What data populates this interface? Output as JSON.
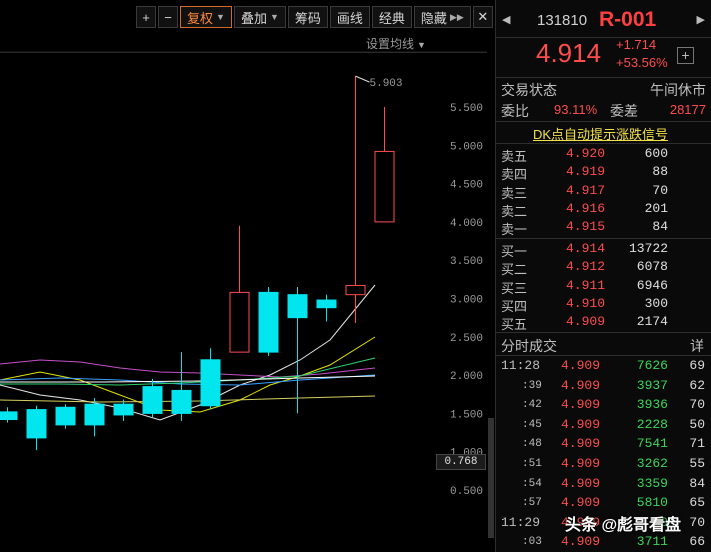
{
  "toolbar": {
    "plus": "+",
    "minus": "−",
    "fuquan": "复权",
    "diejia": "叠加",
    "chouma": "筹码",
    "huaxian": "画线",
    "jingdian": "经典",
    "yincang": "隐藏",
    "set_ma": "设置均线"
  },
  "colors": {
    "up": "#ff4d4d",
    "down": "#00e5ee",
    "accent": "#ff8a3d",
    "trade_vol": "#3cd65a"
  },
  "chart_data": {
    "type": "candlestick",
    "ylabels": [
      "5.500",
      "5.000",
      "4.500",
      "4.000",
      "3.500",
      "3.000",
      "2.500",
      "2.000",
      "1.500",
      "1.000",
      "0.500"
    ],
    "current_price_label": "0.768",
    "high_annotation": "5.903",
    "candles": [
      {
        "o": 1.52,
        "c": 1.42,
        "h": 1.58,
        "l": 1.38
      },
      {
        "o": 1.55,
        "c": 1.18,
        "h": 1.6,
        "l": 1.02
      },
      {
        "o": 1.58,
        "c": 1.35,
        "h": 1.62,
        "l": 1.3
      },
      {
        "o": 1.62,
        "c": 1.35,
        "h": 1.7,
        "l": 1.2
      },
      {
        "o": 1.62,
        "c": 1.48,
        "h": 1.68,
        "l": 1.4
      },
      {
        "o": 1.85,
        "c": 1.5,
        "h": 1.95,
        "l": 1.45
      },
      {
        "o": 1.8,
        "c": 1.5,
        "h": 2.3,
        "l": 1.4
      },
      {
        "o": 2.2,
        "c": 1.6,
        "h": 2.35,
        "l": 1.55
      },
      {
        "o": 2.3,
        "c": 3.08,
        "h": 3.95,
        "l": 2.3
      },
      {
        "o": 3.08,
        "c": 2.3,
        "h": 3.15,
        "l": 2.25
      },
      {
        "o": 3.05,
        "c": 2.75,
        "h": 3.15,
        "l": 1.5
      },
      {
        "o": 2.98,
        "c": 2.88,
        "h": 3.05,
        "l": 2.7
      },
      {
        "o": 3.05,
        "c": 3.17,
        "h": 5.903,
        "l": 2.68
      },
      {
        "o": 4.0,
        "c": 4.92,
        "h": 5.5,
        "l": 4.0
      }
    ]
  },
  "quote": {
    "prev": "◀",
    "next": "▶",
    "code": "131810",
    "name": "R-001",
    "price": "4.914",
    "chg_abs": "+1.714",
    "chg_pct": "+53.56%",
    "plus_btn": "+",
    "status_label": "交易状态",
    "status_value": "午间休市",
    "ratio_label": "委比",
    "ratio_value": "93.11%",
    "diff_label": "委差",
    "diff_value": "28177",
    "dk_link": "DK点自动提示涨跌信号",
    "asks": [
      {
        "label": "卖五",
        "price": "4.920",
        "vol": "600"
      },
      {
        "label": "卖四",
        "price": "4.919",
        "vol": "88"
      },
      {
        "label": "卖三",
        "price": "4.917",
        "vol": "70"
      },
      {
        "label": "卖二",
        "price": "4.916",
        "vol": "201"
      },
      {
        "label": "卖一",
        "price": "4.915",
        "vol": "84"
      }
    ],
    "bids": [
      {
        "label": "买一",
        "price": "4.914",
        "vol": "13722"
      },
      {
        "label": "买二",
        "price": "4.912",
        "vol": "6078"
      },
      {
        "label": "买三",
        "price": "4.911",
        "vol": "6946"
      },
      {
        "label": "买四",
        "price": "4.910",
        "vol": "300"
      },
      {
        "label": "买五",
        "price": "4.909",
        "vol": "2174"
      }
    ],
    "trades_title": "分时成交",
    "trades_detail": "详",
    "trades": [
      {
        "time": "11:28",
        "sub": false,
        "price": "4.909",
        "vol": "7626",
        "n": "69"
      },
      {
        "time": ":39",
        "sub": true,
        "price": "4.909",
        "vol": "3937",
        "n": "62"
      },
      {
        "time": ":42",
        "sub": true,
        "price": "4.909",
        "vol": "3936",
        "n": "70"
      },
      {
        "time": ":45",
        "sub": true,
        "price": "4.909",
        "vol": "2228",
        "n": "50"
      },
      {
        "time": ":48",
        "sub": true,
        "price": "4.909",
        "vol": "7541",
        "n": "71"
      },
      {
        "time": ":51",
        "sub": true,
        "price": "4.909",
        "vol": "3262",
        "n": "55"
      },
      {
        "time": ":54",
        "sub": true,
        "price": "4.909",
        "vol": "3359",
        "n": "84"
      },
      {
        "time": ":57",
        "sub": true,
        "price": "4.909",
        "vol": "5810",
        "n": "65"
      },
      {
        "time": "11:29",
        "sub": false,
        "price": "4.909",
        "vol": "0",
        "n": "70"
      },
      {
        "time": ":03",
        "sub": true,
        "price": "4.909",
        "vol": "3711",
        "n": "66"
      }
    ]
  },
  "watermark": "头条 @彪哥看盘"
}
